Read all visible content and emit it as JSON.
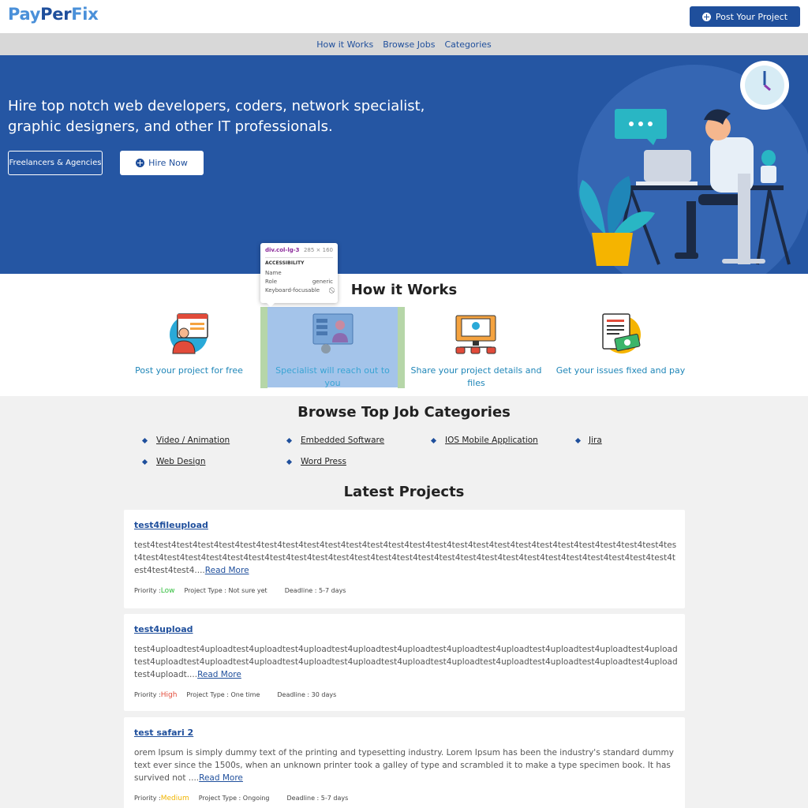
{
  "header": {
    "logo": {
      "pay": "Pay",
      "per": "Per",
      "fix": "Fix"
    },
    "post_button": "Post Your Project"
  },
  "nav": [
    "How it Works",
    "Browse Jobs",
    "Categories"
  ],
  "hero": {
    "title": "Hire top notch web developers, coders, network specialist, graphic designers, and other IT professionals.",
    "btn_freelancers": "Freelancers & Agencies",
    "btn_hire": "Hire Now"
  },
  "how": {
    "title": "How it Works",
    "steps": [
      "Post your project for free",
      "Specialist will reach out to you",
      "Share your project details and files",
      "Get your issues fixed and pay"
    ]
  },
  "devtools_tooltip": {
    "class_name": "div.col-lg-3",
    "size": "285 × 160",
    "section": "ACCESSIBILITY",
    "rows": [
      {
        "k": "Name",
        "v": ""
      },
      {
        "k": "Role",
        "v": "generic"
      },
      {
        "k": "Keyboard-focusable",
        "v": "⃠"
      }
    ]
  },
  "categories": {
    "title": "Browse Top Job Categories",
    "items": [
      "Video / Animation",
      "Embedded Software",
      "IOS Mobile Application",
      "Jira",
      "Web Design",
      "Word Press"
    ]
  },
  "latest": {
    "title": "Latest Projects",
    "projects": [
      {
        "title": "test4fileupload",
        "desc": "test4test4test4test4test4test4test4test4test4test4test4test4test4test4test4test4test4test4test4test4test4test4test4test4test4test4test4test4test4test4test4test4test4test4test4test4test4test4test4test4test4test4test4test4test4test4test4test4test4test4test4test4test4test4....",
        "more": "Read More",
        "priority_label": "Priority : ",
        "priority": "Low",
        "type": "Project Type : Not sure yet",
        "deadline": "Deadline : 5-7 days"
      },
      {
        "title": "test4upload",
        "desc": "test4uploadtest4uploadtest4uploadtest4uploadtest4uploadtest4uploadtest4uploadtest4uploadtest4uploadtest4uploadtest4uploadtest4uploadtest4uploadtest4uploadtest4uploadtest4uploadtest4uploadtest4uploadtest4uploadtest4uploadtest4uploadtest4uploadtest4uploadt....",
        "more": "Read More",
        "priority_label": "Priority : ",
        "priority": "High",
        "type": "Project Type : One time",
        "deadline": "Deadline : 30 days"
      },
      {
        "title": "test safari 2",
        "desc": "orem Ipsum is simply dummy text of the printing and typesetting industry. Lorem Ipsum has been the industry's standard dummy text ever since the 1500s, when an unknown printer took a galley of type and scrambled it to make a type specimen book. It has survived not ....",
        "more": "Read More",
        "priority_label": "Priority : ",
        "priority": "Medium",
        "type": "Project Type : Ongoing",
        "deadline": "Deadline : 5-7 days"
      }
    ]
  },
  "colors": {
    "brand": "#1f4f9c",
    "hero_bg": "#2556a3",
    "link": "#1f86b8",
    "low": "#2ebd3a",
    "high": "#e24b3a",
    "medium": "#f0b400"
  }
}
